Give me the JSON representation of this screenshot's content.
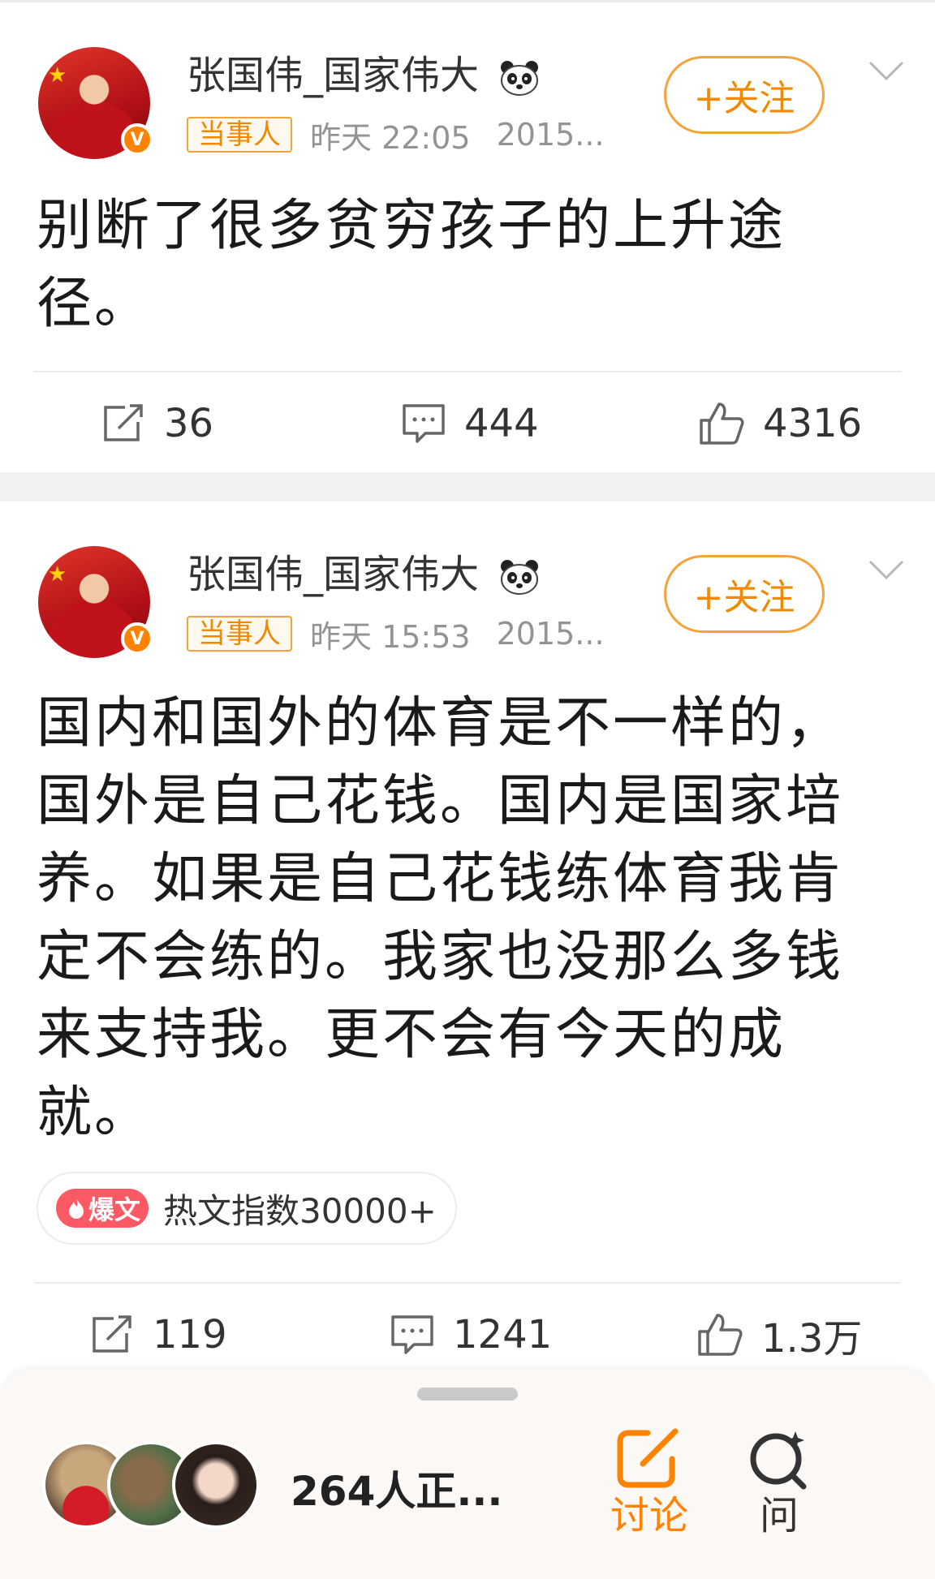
{
  "colors": {
    "accent_orange": "#ff8200",
    "follow_border": "#f6a23a",
    "badge_orange": "#ef8a00",
    "time_gray": "#939393",
    "hot_red": "#fb5a65"
  },
  "posts": [
    {
      "username": "张国伟_国家伟大",
      "user_badge_icon": "panda-icon",
      "verified_icon": "verified-v-icon",
      "role_badge": "当事人",
      "time": "昨天 22:05",
      "date": "2015...",
      "follow_label": "+关注",
      "content_lines": [
        "别断了很多贫穷孩子的上升途",
        "径。"
      ],
      "repost_count": "36",
      "comment_count": "444",
      "like_count": "4316"
    },
    {
      "username": "张国伟_国家伟大",
      "user_badge_icon": "panda-icon",
      "verified_icon": "verified-v-icon",
      "role_badge": "当事人",
      "time": "昨天 15:53",
      "date": "2015...",
      "follow_label": "+关注",
      "content_lines": [
        "国内和国外的体育是不一样的，",
        "国外是自己花钱。国内是国家培",
        "养。如果是自己花钱练体育我肯",
        "定不会练的。我家也没那么多钱",
        "来支持我。更不会有今天的成",
        "就。"
      ],
      "hot_badge_label": "爆文",
      "hot_text": "热文指数30000+",
      "repost_count": "119",
      "comment_count": "1241",
      "like_count": "1.3万"
    }
  ],
  "bottom_bar": {
    "viewers_text": "264人正...",
    "tab_discuss": "讨论",
    "tab_ask": "问"
  }
}
